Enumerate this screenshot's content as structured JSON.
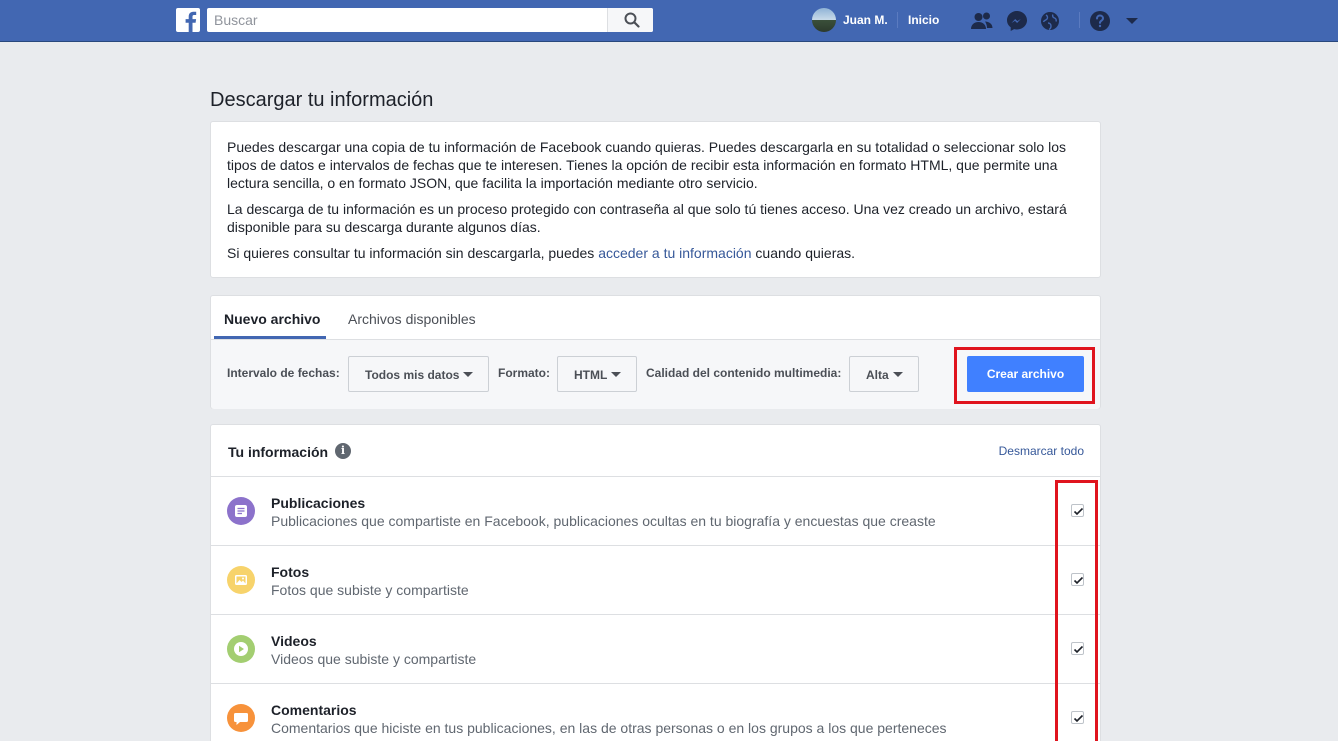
{
  "header": {
    "search_placeholder": "Buscar",
    "user_name": "Juan M.",
    "home_label": "Inicio",
    "brand_color": "#4267b2"
  },
  "page": {
    "title": "Descargar tu información"
  },
  "intro": {
    "p1": "Puedes descargar una copia de tu información de Facebook cuando quieras. Puedes descargarla en su totalidad o seleccionar solo los tipos de datos e intervalos de fechas que te interesen. Tienes la opción de recibir esta información en formato HTML, que permite una lectura sencilla, o en formato JSON, que facilita la importación mediante otro servicio.",
    "p2": "La descarga de tu información es un proceso protegido con contraseña al que solo tú tienes acceso. Una vez creado un archivo, estará disponible para su descarga durante algunos días.",
    "p3_before": "Si quieres consultar tu información sin descargarla, puedes ",
    "p3_link": "acceder a tu información",
    "p3_after": " cuando quieras."
  },
  "tabs": {
    "new_file": "Nuevo archivo",
    "available_files": "Archivos disponibles"
  },
  "filters": {
    "date_label": "Intervalo de fechas:",
    "date_value": "Todos mis datos",
    "format_label": "Formato:",
    "format_value": "HTML",
    "quality_label": "Calidad del contenido multimedia:",
    "quality_value": "Alta",
    "create_button": "Crear archivo"
  },
  "info": {
    "title": "Tu información",
    "info_glyph": "i",
    "unmark_all": "Desmarcar todo",
    "items": [
      {
        "title": "Publicaciones",
        "desc": "Publicaciones que compartiste en Facebook, publicaciones ocultas en tu biografía y encuestas que creaste",
        "icon": "posts-icon",
        "color": "#8c72cb",
        "checked": true
      },
      {
        "title": "Fotos",
        "desc": "Fotos que subiste y compartiste",
        "icon": "photos-icon",
        "color": "#f7d36b",
        "checked": true
      },
      {
        "title": "Videos",
        "desc": "Videos que subiste y compartiste",
        "icon": "videos-icon",
        "color": "#a3ce71",
        "checked": true
      },
      {
        "title": "Comentarios",
        "desc": "Comentarios que hiciste en tus publicaciones, en las de otras personas o en los grupos a los que perteneces",
        "icon": "comments-icon",
        "color": "#f7923b",
        "checked": true
      }
    ]
  }
}
